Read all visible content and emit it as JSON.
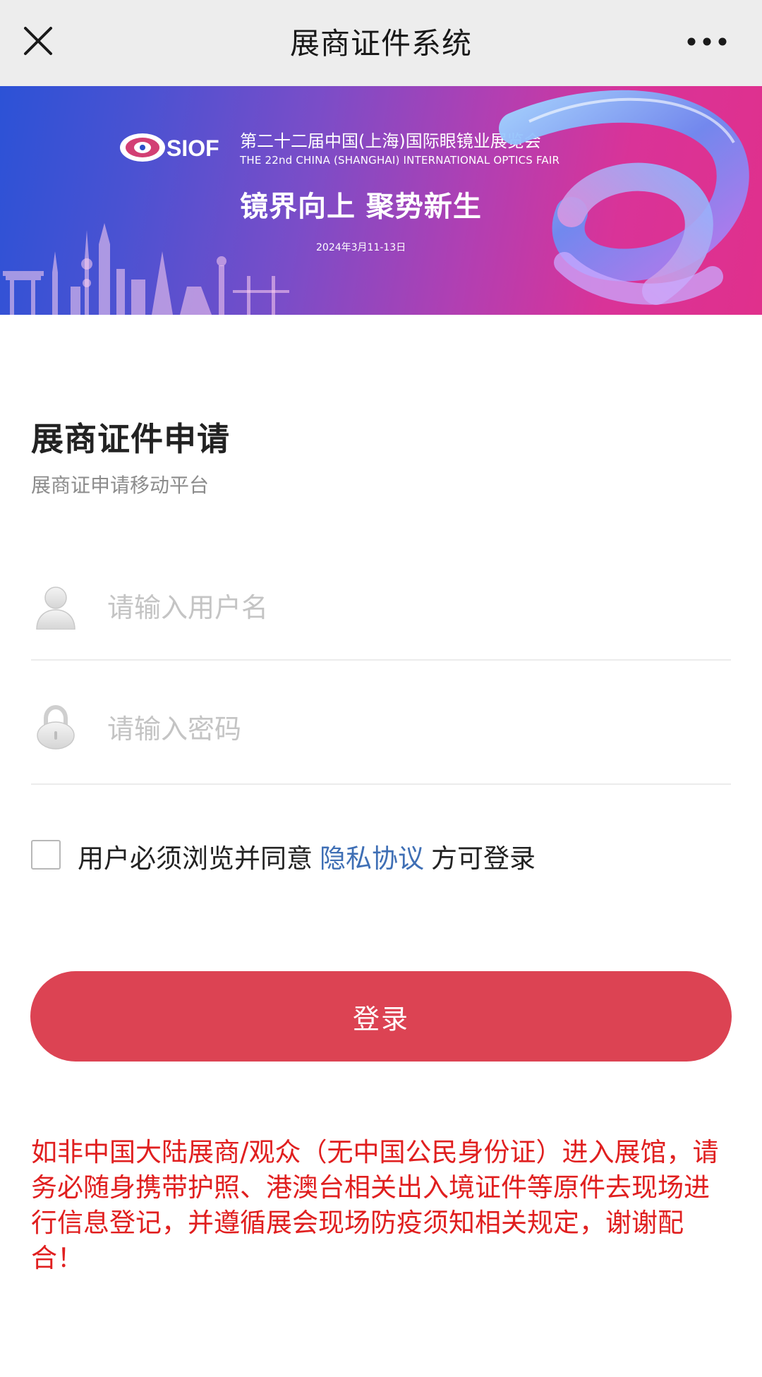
{
  "header": {
    "title": "展商证件系统",
    "close_icon": "close-icon",
    "more_icon": "more-dots-icon"
  },
  "banner": {
    "logo_text": "SIOF",
    "event_name_cn": "第二十二届中国(上海)国际眼镜业展览会",
    "event_name_en": "THE 22nd CHINA (SHANGHAI) INTERNATIONAL OPTICS FAIR",
    "slogan": "镜界向上 聚势新生",
    "date": "2024年3月11-13日"
  },
  "form": {
    "title": "展商证件申请",
    "subtitle": "展商证申请移动平台",
    "username": {
      "placeholder": "请输入用户名",
      "value": "",
      "icon": "user-icon"
    },
    "password": {
      "placeholder": "请输入密码",
      "value": "",
      "icon": "lock-icon"
    },
    "agreement": {
      "checked": false,
      "prefix": "用户必须浏览并同意",
      "link_text": "隐私协议",
      "suffix": "方可登录"
    },
    "login_label": "登录"
  },
  "notice": "如非中国大陆展商/观众（无中国公民身份证）进入展馆，请务必随身携带护照、港澳台相关出入境证件等原件去现场进行信息登记，并遵循展会现场防疫须知相关规定，谢谢配合！",
  "colors": {
    "primary_button": "#dc4353",
    "link": "#3f6fb5",
    "notice": "#e01f1f",
    "header_bg": "#ededed"
  }
}
